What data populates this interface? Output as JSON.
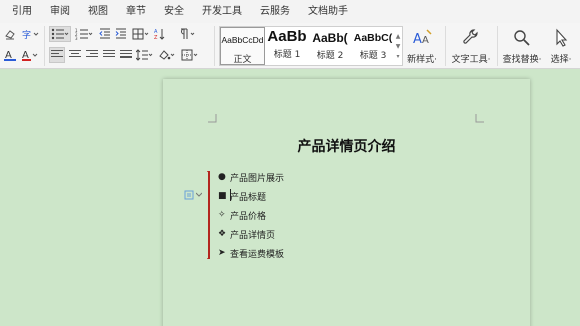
{
  "menu": {
    "items": [
      "引用",
      "审阅",
      "视图",
      "章节",
      "安全",
      "开发工具",
      "云服务",
      "文档助手"
    ]
  },
  "ribbon": {
    "styles": [
      {
        "sample": "AaBbCcDd",
        "name": "正文"
      },
      {
        "sample": "AaBb",
        "name": "标题 1"
      },
      {
        "sample": "AaBb(",
        "name": "标题 2"
      },
      {
        "sample": "AaBbC(",
        "name": "标题 3"
      }
    ],
    "new_style_label": "新样式·",
    "text_tools_label": "文字工具·",
    "find_replace_label": "查找替换·",
    "select_label": "选择·"
  },
  "document": {
    "title": "产品详情页介绍",
    "list": [
      {
        "bullet": "●",
        "text": "产品图片展示"
      },
      {
        "bullet": "■",
        "text": "产品标题"
      },
      {
        "bullet": "✧",
        "text": "产品价格"
      },
      {
        "bullet": "❖",
        "text": "产品详情页"
      },
      {
        "bullet": "➤",
        "text": "查看运费模板"
      }
    ]
  },
  "colors": {
    "background": "#cde6c9",
    "page": "#cfe7cb",
    "red_bar": "#b3261e",
    "font_red": "#d22222",
    "font_blue": "#2a5bd7"
  }
}
